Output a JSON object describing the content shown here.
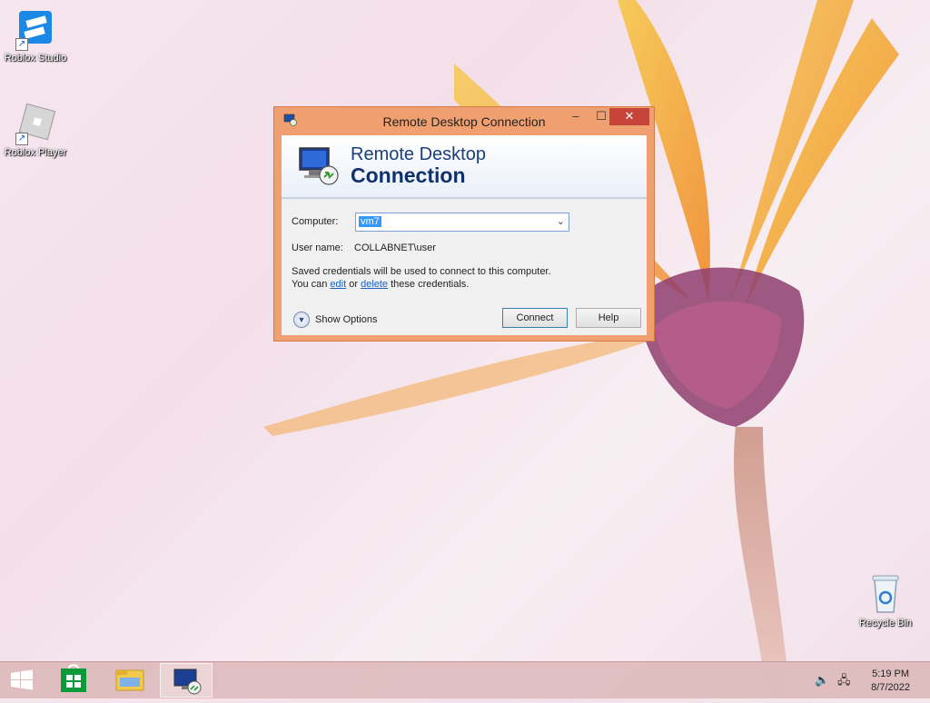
{
  "desktop": {
    "icons": [
      {
        "label": "Roblox Studio"
      },
      {
        "label": "Roblox Player"
      },
      {
        "label": "Recycle Bin"
      }
    ]
  },
  "dialog": {
    "window_title": "Remote Desktop Connection",
    "banner_line1": "Remote Desktop",
    "banner_line2": "Connection",
    "computer_label": "Computer:",
    "computer_value": "vm7",
    "username_label": "User name:",
    "username_value": "COLLABNET\\user",
    "saved_line1": "Saved credentials will be used to connect to this computer.",
    "saved_line2_prefix": "You can",
    "edit_link": "edit",
    "saved_line2_or": "or",
    "delete_link": "delete",
    "saved_line2_suffix": "these credentials.",
    "show_options_label": "Show Options",
    "connect_label": "Connect",
    "help_label": "Help"
  },
  "taskbar": {
    "apps": [
      "start-button",
      "store-icon",
      "file-explorer-icon",
      "remote-desktop-icon"
    ],
    "time": "5:19 PM",
    "date": "8/7/2022"
  },
  "colors": {
    "window_frame": "#f0a070",
    "close_button": "#c7443b",
    "selection": "#3399ff",
    "link": "#1a5fbf"
  }
}
